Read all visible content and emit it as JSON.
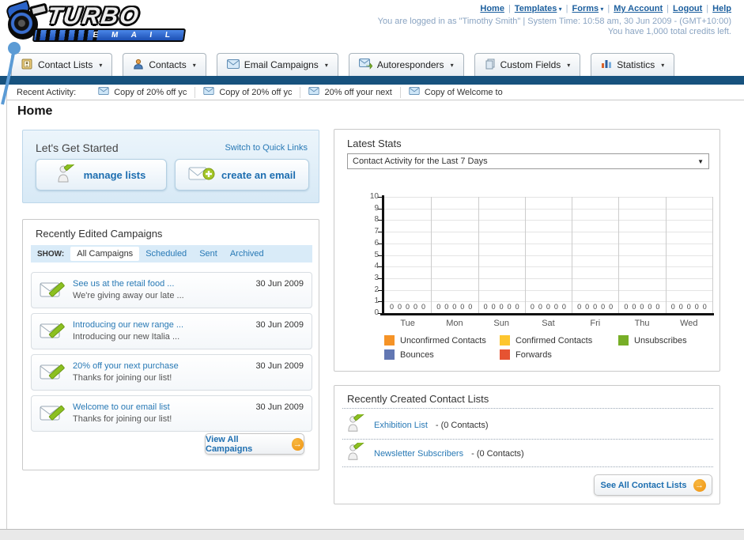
{
  "logo": {
    "title": "TURBO",
    "subtitle": "E M A I L"
  },
  "header": {
    "nav_items": [
      {
        "label": "Home",
        "dropdown": false
      },
      {
        "label": "Templates",
        "dropdown": true
      },
      {
        "label": "Forms",
        "dropdown": true
      },
      {
        "label": "My Account",
        "dropdown": false
      },
      {
        "label": "Logout",
        "dropdown": false
      },
      {
        "label": "Help",
        "dropdown": false
      }
    ],
    "separator": "|",
    "login_line": "You are logged in as \"Timothy Smith\" | System Time: 10:58 am, 30 Jun 2009 - (GMT+10:00)",
    "credits_line": "You have 1,000 total credits left."
  },
  "main_tabs": [
    {
      "label": "Contact Lists",
      "icon": "address-book-icon"
    },
    {
      "label": "Contacts",
      "icon": "person-icon"
    },
    {
      "label": "Email Campaigns",
      "icon": "envelope-icon"
    },
    {
      "label": "Autoresponders",
      "icon": "envelope-arrow-icon"
    },
    {
      "label": "Custom Fields",
      "icon": "pages-icon"
    },
    {
      "label": "Statistics",
      "icon": "bar-chart-icon"
    }
  ],
  "recent_activity": {
    "label": "Recent Activity:",
    "items": [
      "Copy of 20% off yc",
      "Copy of 20% off yc",
      "20% off your next",
      "Copy of Welcome to"
    ]
  },
  "page_title": "Home",
  "get_started": {
    "title": "Let's Get Started",
    "switch_link": "Switch to Quick Links",
    "buttons": [
      {
        "label": "manage lists",
        "icon": "person-pencil-icon"
      },
      {
        "label": "create an email",
        "icon": "envelope-plus-icon"
      }
    ]
  },
  "campaigns": {
    "title": "Recently Edited Campaigns",
    "show_label": "SHOW:",
    "filter_tabs": [
      "All Campaigns",
      "Scheduled",
      "Sent",
      "Archived"
    ],
    "active_filter": "All Campaigns",
    "items": [
      {
        "title": "See us at the retail food ...",
        "subtitle": "We're giving away our late ...",
        "date": "30 Jun 2009"
      },
      {
        "title": "Introducing our new range ...",
        "subtitle": "Introducing our new Italia ...",
        "date": "30 Jun 2009"
      },
      {
        "title": "20% off your next purchase",
        "subtitle": "Thanks for joining our list!",
        "date": "30 Jun 2009"
      },
      {
        "title": "Welcome to our email list",
        "subtitle": "Thanks for joining our list!",
        "date": "30 Jun 2009"
      }
    ],
    "view_all_label": "View All Campaigns"
  },
  "stats": {
    "title": "Latest Stats",
    "dropdown_value": "Contact Activity for the Last 7 Days",
    "chart_data": {
      "type": "bar",
      "categories": [
        "Tue",
        "Mon",
        "Sun",
        "Sat",
        "Fri",
        "Thu",
        "Wed"
      ],
      "series": [
        {
          "name": "Unconfirmed Contacts",
          "color": "#F59327",
          "values": [
            0,
            0,
            0,
            0,
            0,
            0,
            0
          ]
        },
        {
          "name": "Confirmed Contacts",
          "color": "#FDC62F",
          "values": [
            0,
            0,
            0,
            0,
            0,
            0,
            0
          ]
        },
        {
          "name": "Unsubscribes",
          "color": "#77AE27",
          "values": [
            0,
            0,
            0,
            0,
            0,
            0,
            0
          ]
        },
        {
          "name": "Bounces",
          "color": "#6277B3",
          "values": [
            0,
            0,
            0,
            0,
            0,
            0,
            0
          ]
        },
        {
          "name": "Forwards",
          "color": "#E65332",
          "values": [
            0,
            0,
            0,
            0,
            0,
            0,
            0
          ]
        }
      ],
      "ylim": [
        0,
        10
      ],
      "y_ticks": [
        0,
        1,
        2,
        3,
        4,
        5,
        6,
        7,
        8,
        9,
        10
      ],
      "grid": true,
      "value_labels_shown": true,
      "legend_position": "bottom"
    }
  },
  "contact_lists": {
    "title": "Recently Created Contact Lists",
    "items": [
      {
        "name": "Exhibition List",
        "count_text": "- (0 Contacts)"
      },
      {
        "name": "Newsletter Subscribers",
        "count_text": "- (0 Contacts)"
      }
    ],
    "see_all_label": "See All Contact Lists"
  }
}
